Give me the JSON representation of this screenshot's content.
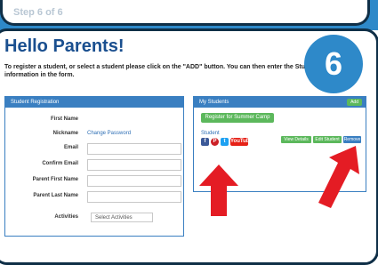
{
  "header": {
    "faint_text": "Step 6 of 6"
  },
  "badge": {
    "number": "6"
  },
  "greeting": "Hello Parents!",
  "intro": "To register a student, or select a student please click on the \"ADD\" button. You can then enter the Student information in the form.",
  "registration": {
    "title": "Student Registration",
    "fields": [
      {
        "label": "First Name",
        "kind": "text",
        "value": ""
      },
      {
        "label": "Nickname",
        "kind": "link",
        "value": "Change Password"
      },
      {
        "label": "Email",
        "kind": "input",
        "value": ""
      },
      {
        "label": "Confirm Email",
        "kind": "input",
        "value": ""
      },
      {
        "label": "Parent First Name",
        "kind": "input",
        "value": ""
      },
      {
        "label": "Parent Last Name",
        "kind": "input",
        "value": ""
      },
      {
        "label": "Activities",
        "kind": "select",
        "value": "Select Activities"
      }
    ]
  },
  "my_students": {
    "title": "My Students",
    "add_button": "Add",
    "green_button": "Register for Summer Camp",
    "student_name": "Student",
    "social": [
      "f",
      "P",
      "t",
      "YouTube"
    ],
    "actions": [
      "View Details",
      "Edit Student",
      "Remove"
    ]
  },
  "colors": {
    "brand": "#2e89c9",
    "dark": "#0f2f47",
    "arrow": "#e41c24",
    "green": "#5cb85c"
  }
}
